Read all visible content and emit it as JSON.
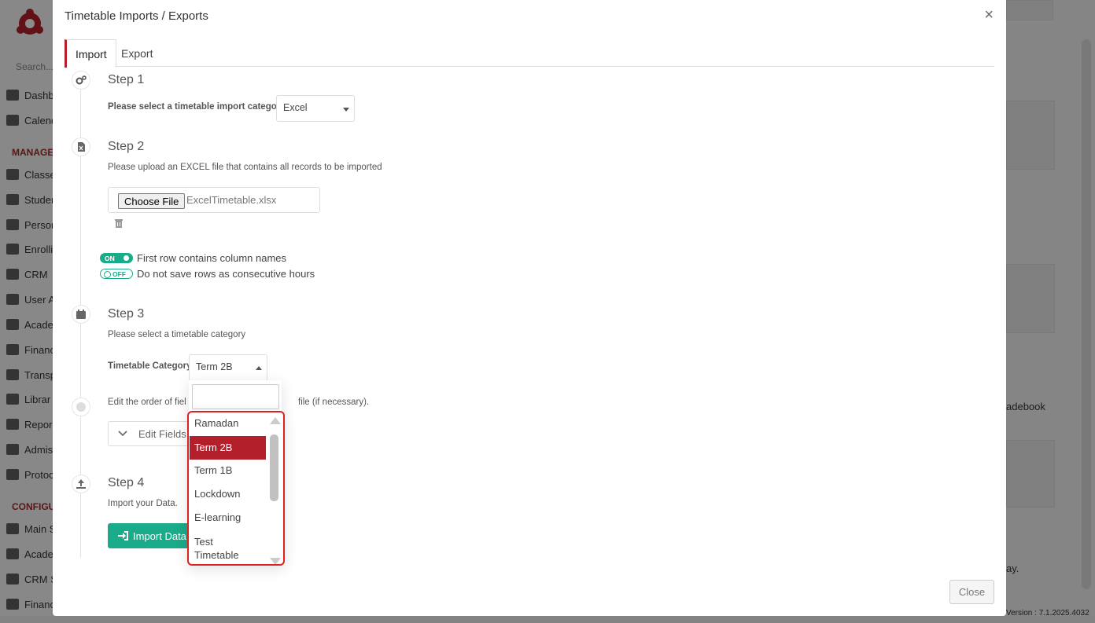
{
  "background": {
    "search_placeholder": "Search...",
    "sidebar_items_top": [
      "Dashb",
      "Calend"
    ],
    "section_manage": "MANAGE",
    "sidebar_items_manage": [
      "Classe",
      "Studen",
      "Person",
      "Enrolli",
      "CRM",
      "User A",
      "Acade",
      "Financ",
      "Transp",
      "Librar",
      "Repor",
      "Admis",
      "Protoc"
    ],
    "section_config": "CONFIGU",
    "sidebar_items_config": [
      "Main S",
      "Acade",
      "CRM S",
      "Financ"
    ],
    "right_text_gradebook": "adebook",
    "right_text_fragment": "ay.",
    "version_text": "Version : 7.1.2025.4032",
    "accent_color": "#b3202b"
  },
  "modal": {
    "title": "Timetable Imports / Exports",
    "close_glyph": "×",
    "tabs": [
      {
        "label": "Import",
        "active": true
      },
      {
        "label": "Export",
        "active": false
      }
    ],
    "step1": {
      "title": "Step 1",
      "label": "Please select a timetable import category",
      "select_value": "Excel"
    },
    "step2": {
      "title": "Step 2",
      "description": "Please upload an EXCEL file that contains all records to be imported",
      "choose_file_label": "Choose File",
      "file_name": "ExcelTimetable.xlsx",
      "toggle1": {
        "state": "ON",
        "label": "First row contains column names"
      },
      "toggle2": {
        "state": "OFF",
        "label": "Do not save rows as consecutive hours"
      }
    },
    "step3": {
      "title": "Step 3",
      "description": "Please select a timetable category",
      "category_label": "Timetable Category",
      "category_value": "Term 2B",
      "edit_order_text_left": "Edit the order of fiel",
      "edit_order_text_right": "file (if necessary).",
      "edit_fields_label": "Edit Fields"
    },
    "step4": {
      "title": "Step 4",
      "description": "Import your Data.",
      "import_button": "Import Data"
    },
    "close_button": "Close"
  },
  "dropdown": {
    "search_value": "",
    "options": [
      "Ramadan",
      "Term 2B",
      "Term 1B",
      "Lockdown",
      "E-learning",
      "Test Timetable"
    ],
    "selected": "Term 2B",
    "highlight_color": "#d22"
  }
}
